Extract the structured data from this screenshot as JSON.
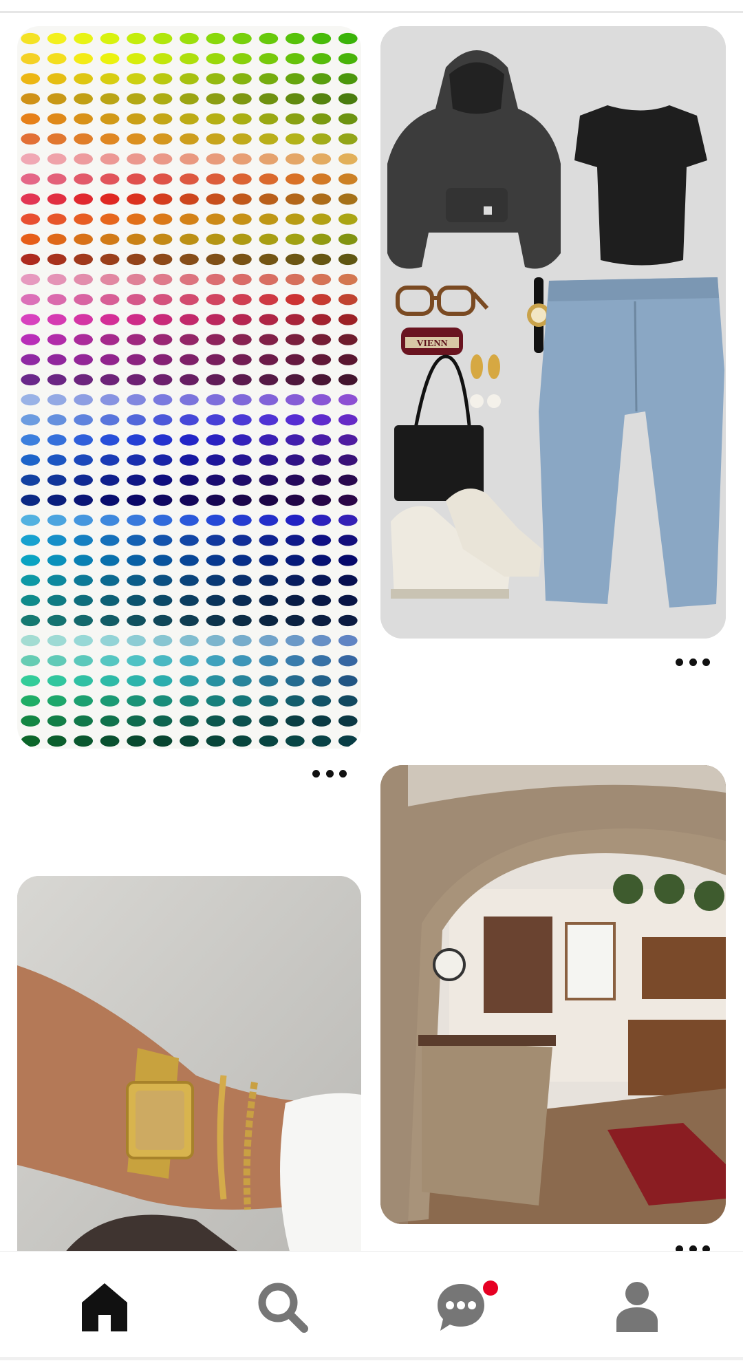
{
  "feed": {
    "pins": [
      {
        "id_label": "pin-color-chart",
        "kind": "image"
      },
      {
        "id_label": "pin-outfit",
        "kind": "image",
        "tag_text": "VIENN"
      },
      {
        "id_label": "pin-watch",
        "kind": "image"
      },
      {
        "id_label": "pin-kitchen",
        "kind": "image"
      }
    ],
    "more_options_icon": "ellipsis-icon"
  },
  "nav": {
    "items": [
      {
        "icon": "home-icon",
        "active": true
      },
      {
        "icon": "search-icon",
        "active": false
      },
      {
        "icon": "chat-icon",
        "active": false,
        "has_notification": true
      },
      {
        "icon": "profile-icon",
        "active": false
      }
    ],
    "accent": "#e60023",
    "active_color": "#111111",
    "inactive_color": "#767676"
  }
}
